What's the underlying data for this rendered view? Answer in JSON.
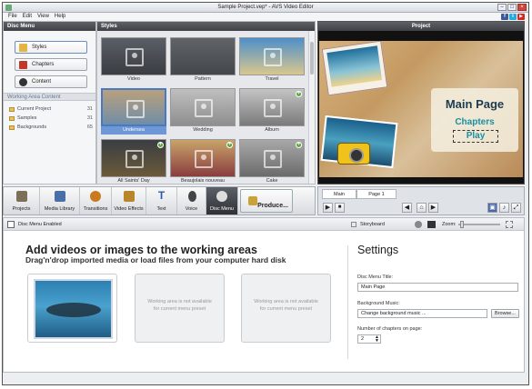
{
  "window": {
    "title": "Sample Project.vep* - AVS Video Editor"
  },
  "menu": [
    "File",
    "Edit",
    "View",
    "Help"
  ],
  "social": [
    {
      "name": "facebook-icon",
      "label": "f",
      "color": "#3b5998"
    },
    {
      "name": "twitter-icon",
      "label": "t",
      "color": "#2aa9e0"
    },
    {
      "name": "youtube-icon",
      "label": "▶",
      "color": "#d9261c"
    }
  ],
  "disc_menu": {
    "header": "Disc Menu",
    "buttons": [
      {
        "label": "Styles",
        "icon": "styles-icon",
        "color": "#e2b646"
      },
      {
        "label": "Chapters",
        "icon": "chapters-icon",
        "color": "#c0392b"
      },
      {
        "label": "Content",
        "icon": "content-icon",
        "color": "#333"
      }
    ],
    "working_area_header": "Working Area Content",
    "tree": [
      {
        "label": "Current Project",
        "count": "31"
      },
      {
        "label": "Samples",
        "count": "31"
      },
      {
        "label": "Backgrounds",
        "count": "65"
      }
    ]
  },
  "styles": {
    "header": "Styles",
    "items": [
      {
        "label": "Video",
        "bg": "linear-gradient(#5a5f66,#3a3d42)",
        "placeholder": true
      },
      {
        "label": "Pattern",
        "bg": "linear-gradient(#606468,#44474c)",
        "placeholder": false
      },
      {
        "label": "Travel",
        "bg": "linear-gradient(#4e8fc9,#d9c78f)",
        "placeholder": true
      },
      {
        "label": "Undersea",
        "bg": "linear-gradient(#b9a07d,#6f8ea6)",
        "placeholder": true
      },
      {
        "label": "Wedding",
        "bg": "linear-gradient(#bfbfbf,#8e8e8e)",
        "placeholder": true
      },
      {
        "label": "Album",
        "bg": "linear-gradient(#c4c4c4,#7a7a7a)",
        "placeholder": true
      },
      {
        "label": "All Saints' Day",
        "bg": "linear-gradient(#3a3d42,#6b5a3a)",
        "placeholder": true
      },
      {
        "label": "Beaujolais nouveau",
        "bg": "linear-gradient(#c9a36c,#8a3d3d)",
        "placeholder": true
      },
      {
        "label": "Cake",
        "bg": "linear-gradient(#a8a8a8,#6b6b6b)",
        "placeholder": true
      }
    ]
  },
  "project": {
    "header": "Project",
    "preview": {
      "title": "Main Page",
      "chapters": "Chapters",
      "play": "Play"
    }
  },
  "toolbar": [
    {
      "label": "Projects",
      "icon": "projects-icon",
      "color": "#7c6f5a"
    },
    {
      "label": "Media Library",
      "icon": "media-library-icon",
      "color": "#4a6ea8"
    },
    {
      "label": "Transitions",
      "icon": "transitions-icon",
      "color": "#c97a1e"
    },
    {
      "label": "Video Effects",
      "icon": "video-effects-icon",
      "color": "#b8862b"
    },
    {
      "label": "Text",
      "icon": "text-icon",
      "color": "#2d5fa8"
    },
    {
      "label": "Voice",
      "icon": "voice-icon",
      "color": "#444"
    },
    {
      "label": "Disc Menu",
      "icon": "disc-menu-icon",
      "color": "#ddd"
    },
    {
      "label": "Produce...",
      "icon": "produce-icon",
      "color": "#c9a33a"
    }
  ],
  "timeline": {
    "tabs": [
      "Main",
      "Page 1"
    ],
    "buttons": [
      "▶",
      "■",
      "◀",
      "⌂",
      "▶"
    ]
  },
  "bottom": {
    "toggle_label": "Disc Menu Enabled",
    "storyboard_label": "Storyboard",
    "zoom_label": "Zoom:",
    "heading": "Add videos or images to the working areas",
    "subheading": "Drag'n'drop imported media or load files from your computer hard disk",
    "slot_unavailable": "Working area is not available for current menu preset"
  },
  "settings": {
    "title": "Settings",
    "menu_title_label": "Disc Menu Title:",
    "menu_title_value": "Main Page",
    "music_label": "Background Music:",
    "music_value": "Change background music ...",
    "browse_label": "Browse...",
    "chapters_label": "Number of chapters on page:",
    "chapters_value": "2"
  }
}
